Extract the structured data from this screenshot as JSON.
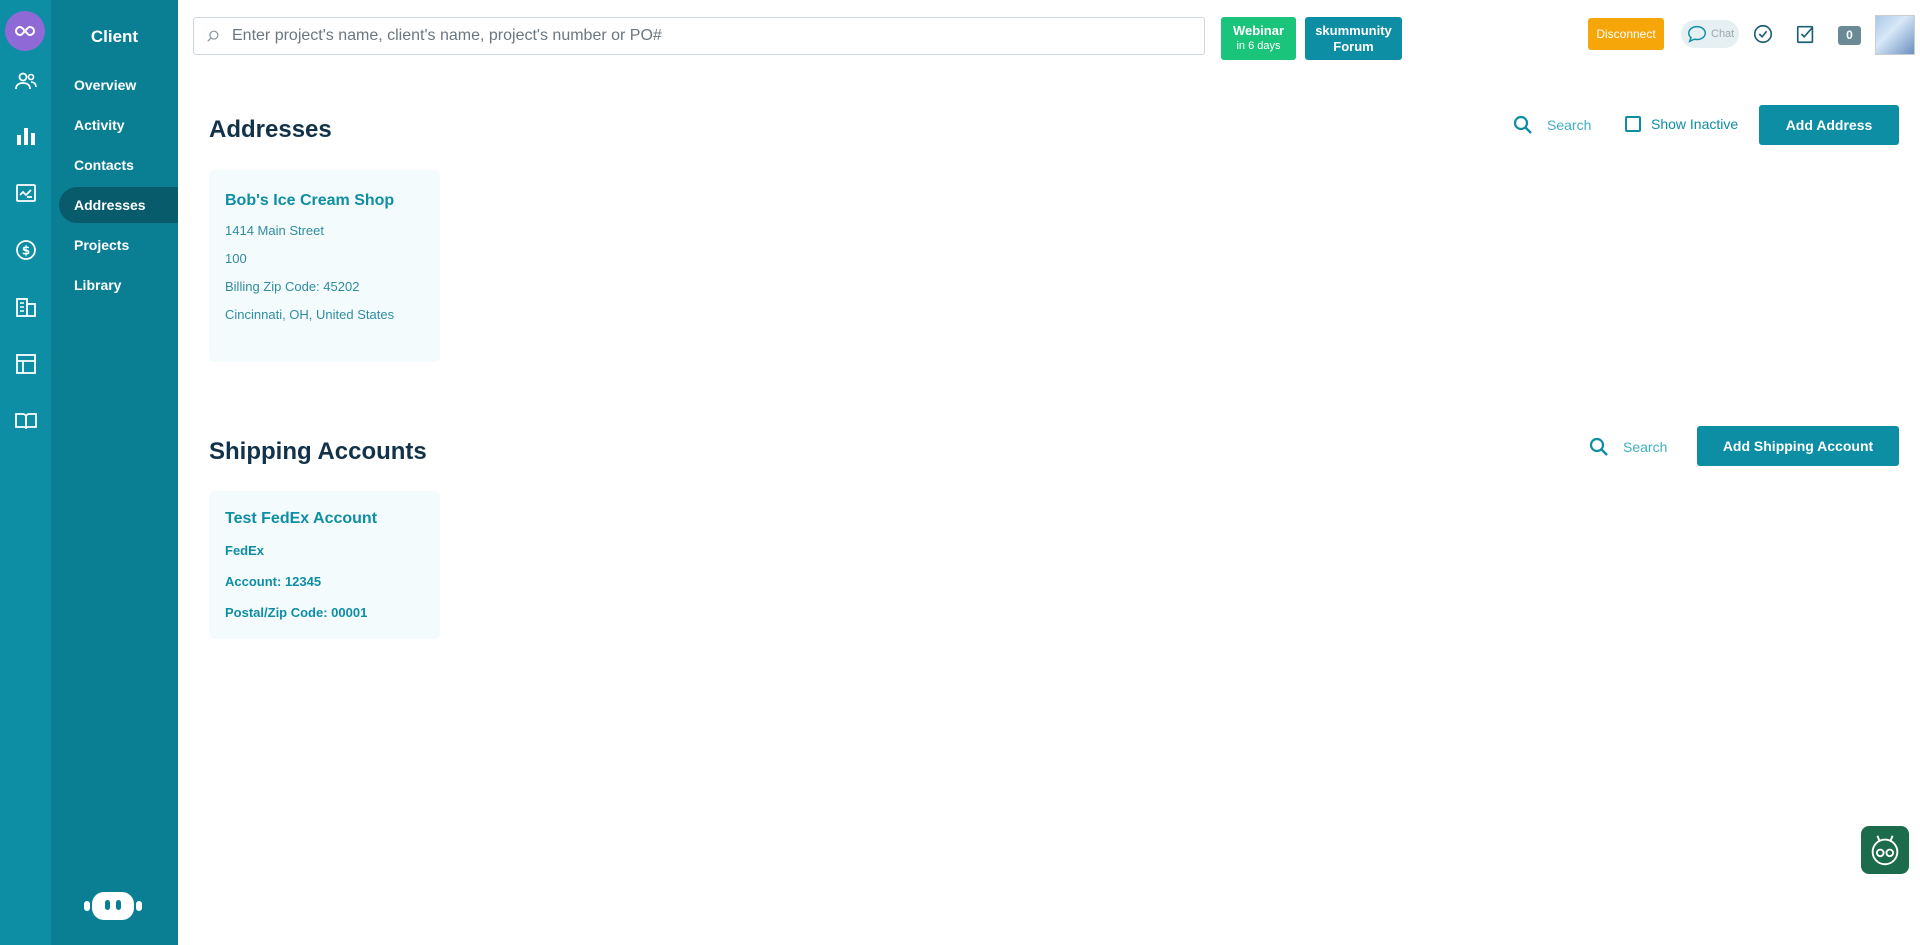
{
  "subnav": {
    "title": "Client",
    "items": [
      "Overview",
      "Activity",
      "Contacts",
      "Addresses",
      "Projects",
      "Library"
    ],
    "active": "Addresses"
  },
  "topbar": {
    "search_placeholder": "Enter project's name, client's name, project's number or PO#",
    "webinar_label": "Webinar",
    "webinar_sub": "in 6 days",
    "forum_line1": "skummunity",
    "forum_line2": "Forum",
    "disconnect_label": "Disconnect",
    "chat_label": "Chat",
    "notification_count": "0"
  },
  "addresses": {
    "title": "Addresses",
    "search_label": "Search",
    "show_inactive_label": "Show Inactive",
    "add_button": "Add Address",
    "cards": [
      {
        "name": "Bob's Ice Cream Shop",
        "line1": "1414 Main Street",
        "line2": "100",
        "billing_zip": "Billing Zip Code: 45202",
        "city": "Cincinnati, OH, United States"
      }
    ]
  },
  "shipping": {
    "title": "Shipping Accounts",
    "search_label": "Search",
    "add_button": "Add Shipping Account",
    "cards": [
      {
        "name": "Test FedEx Account",
        "carrier": "FedEx",
        "account": "Account: 12345",
        "postal": "Postal/Zip Code: 00001"
      }
    ]
  },
  "colors": {
    "rail": "#0e8ea5",
    "subnav": "#0a7f94",
    "active_item": "#075b6a",
    "webinar": "#1bc47b",
    "disconnect": "#f6a609",
    "card_bg": "#f4fbfd"
  }
}
